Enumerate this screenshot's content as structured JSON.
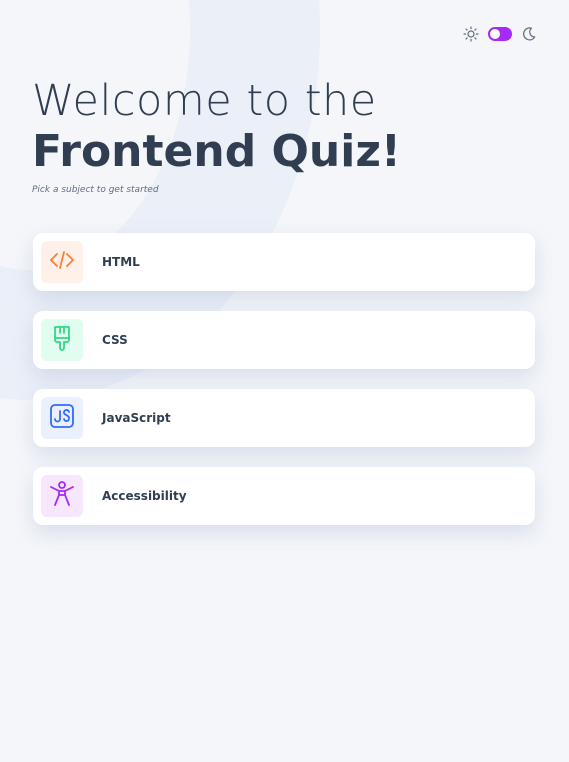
{
  "header": {
    "title_light": "Welcome to the",
    "title_bold": "Frontend Quiz!",
    "subtitle": "Pick a subject to get started"
  },
  "theme": {
    "mode": "dark",
    "light_icon": "sun-icon",
    "dark_icon": "moon-icon",
    "accent": "#a729f5"
  },
  "subjects": [
    {
      "label": "HTML",
      "icon": "html-code-icon",
      "tile_bg": "#fff1e9",
      "icon_color": "#ff7e35"
    },
    {
      "label": "CSS",
      "icon": "paintbrush-icon",
      "tile_bg": "#e0fdef",
      "icon_color": "#2fd887"
    },
    {
      "label": "JavaScript",
      "icon": "js-badge-icon",
      "tile_bg": "#ebf0ff",
      "icon_color": "#306aff"
    },
    {
      "label": "Accessibility",
      "icon": "accessibility-person-icon",
      "tile_bg": "#f6e7ff",
      "icon_color": "#a729f5"
    }
  ]
}
